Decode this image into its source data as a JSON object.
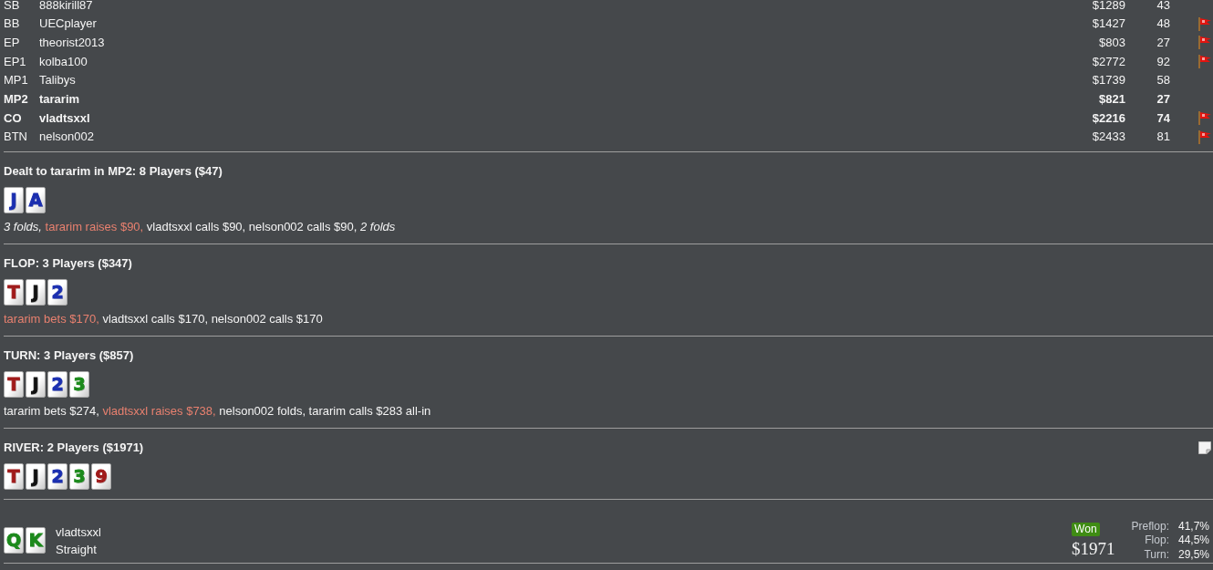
{
  "players": [
    {
      "position": "SB",
      "name": "888kirill87",
      "amount": "$1289",
      "number": "43",
      "bold": false,
      "flagged": false
    },
    {
      "position": "BB",
      "name": "UECplayer",
      "amount": "$1427",
      "number": "48",
      "bold": false,
      "flagged": true
    },
    {
      "position": "EP",
      "name": "theorist2013",
      "amount": "$803",
      "number": "27",
      "bold": false,
      "flagged": true
    },
    {
      "position": "EP1",
      "name": "kolba100",
      "amount": "$2772",
      "number": "92",
      "bold": false,
      "flagged": true
    },
    {
      "position": "MP1",
      "name": "Talibys",
      "amount": "$1739",
      "number": "58",
      "bold": false,
      "flagged": false
    },
    {
      "position": "MP2",
      "name": "tararim",
      "amount": "$821",
      "number": "27",
      "bold": true,
      "flagged": false
    },
    {
      "position": "CO",
      "name": "vladtsxxl",
      "amount": "$2216",
      "number": "74",
      "bold": true,
      "flagged": true
    },
    {
      "position": "BTN",
      "name": "nelson002",
      "amount": "$2433",
      "number": "81",
      "bold": false,
      "flagged": true
    }
  ],
  "streets": [
    {
      "title": "Dealt to tararim in MP2: 8 Players ($47)",
      "note": false,
      "cards": [
        {
          "rank": "J",
          "color": "#1b2fb0"
        },
        {
          "rank": "A",
          "color": "#1b2fb0"
        }
      ],
      "actions": [
        {
          "kind": "fold",
          "text": "3 folds,"
        },
        {
          "kind": "highlight",
          "text": "tararim raises $90,"
        },
        {
          "kind": "plain",
          "text": "vladtsxxl calls $90, nelson002 calls $90,"
        },
        {
          "kind": "fold",
          "text": "2 folds"
        }
      ]
    },
    {
      "title": "FLOP: 3 Players ($347)",
      "note": false,
      "cards": [
        {
          "rank": "T",
          "color": "#a01b1b"
        },
        {
          "rank": "J",
          "color": "#111111"
        },
        {
          "rank": "2",
          "color": "#1b2fb0"
        }
      ],
      "actions": [
        {
          "kind": "highlight",
          "text": "tararim bets $170,"
        },
        {
          "kind": "plain",
          "text": "vladtsxxl calls $170, nelson002 calls $170"
        }
      ]
    },
    {
      "title": "TURN: 3 Players ($857)",
      "note": false,
      "cards": [
        {
          "rank": "T",
          "color": "#a01b1b"
        },
        {
          "rank": "J",
          "color": "#111111"
        },
        {
          "rank": "2",
          "color": "#1b2fb0"
        },
        {
          "rank": "3",
          "color": "#1c8a1c"
        }
      ],
      "actions": [
        {
          "kind": "plain",
          "text": "tararim bets $274,"
        },
        {
          "kind": "highlight",
          "text": "vladtsxxl raises $738,"
        },
        {
          "kind": "plain",
          "text": "nelson002 folds, tararim calls $283 all-in"
        }
      ]
    },
    {
      "title": "RIVER: 2 Players ($1971)",
      "note": true,
      "cards": [
        {
          "rank": "T",
          "color": "#a01b1b"
        },
        {
          "rank": "J",
          "color": "#111111"
        },
        {
          "rank": "2",
          "color": "#1b2fb0"
        },
        {
          "rank": "3",
          "color": "#1c8a1c"
        },
        {
          "rank": "9",
          "color": "#a01b1b"
        }
      ]
    }
  ],
  "showdown": {
    "cards": [
      {
        "rank": "Q",
        "color": "#1c8a1c"
      },
      {
        "rank": "K",
        "color": "#1c8a1c"
      }
    ],
    "player": "vladtsxxl",
    "hand": "Straight",
    "result": "Won",
    "amount": "$1971",
    "equity": [
      {
        "street": "Preflop:",
        "value": "41,7%"
      },
      {
        "street": "Flop:",
        "value": "44,5%"
      },
      {
        "street": "Turn:",
        "value": "29,5%"
      }
    ]
  }
}
